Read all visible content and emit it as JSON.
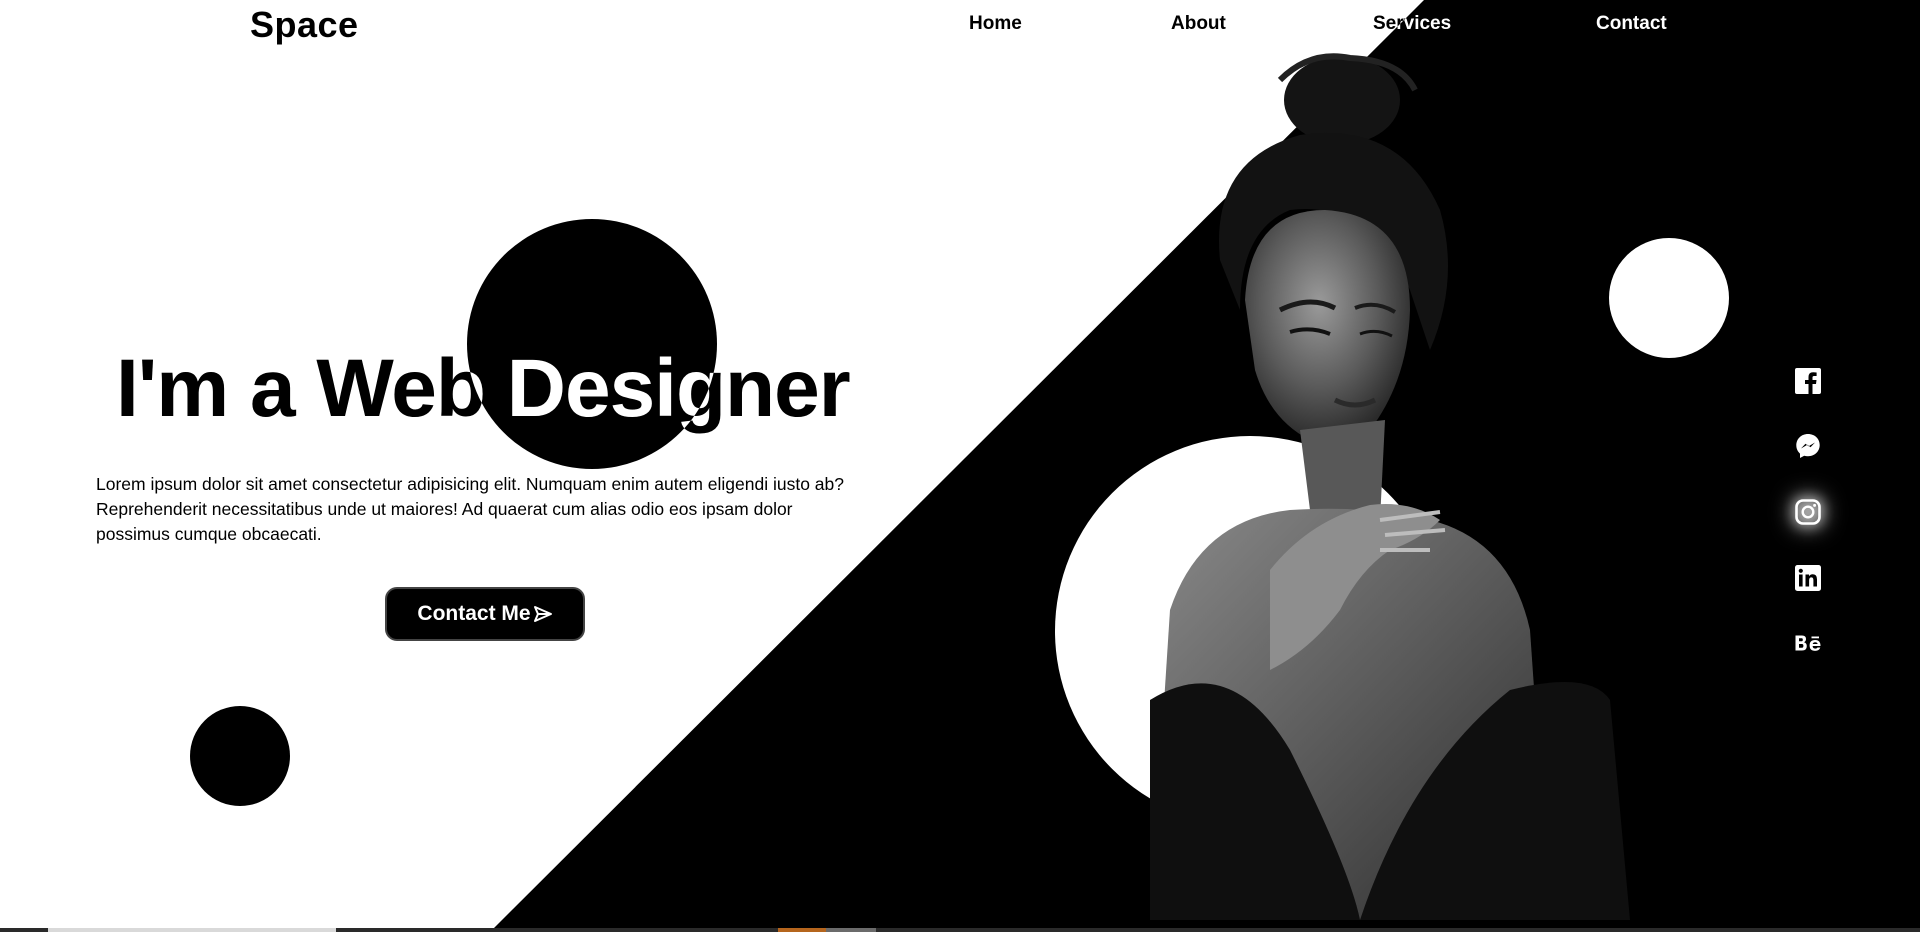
{
  "brand": {
    "logo": "Space"
  },
  "nav": {
    "items": [
      {
        "label": "Home"
      },
      {
        "label": "About"
      },
      {
        "label": "Services"
      },
      {
        "label": "Contact"
      }
    ]
  },
  "hero": {
    "headline": "I'm a Web Designer",
    "paragraph": "Lorem ipsum dolor sit amet consectetur adipisicing elit. Numquam enim autem eligendi iusto ab? Reprehenderit necessitatibus unde ut maiores! Ad quaerat cum alias odio eos ipsam dolor possimus cumque obcaecati.",
    "cta": {
      "label": "Contact Me",
      "icon": "paper-plane-icon"
    }
  },
  "social": {
    "icons": [
      "facebook-icon",
      "messenger-icon",
      "instagram-icon",
      "linkedin-icon",
      "behance-icon"
    ]
  },
  "colors": {
    "primary": "#000000",
    "background": "#ffffff"
  }
}
